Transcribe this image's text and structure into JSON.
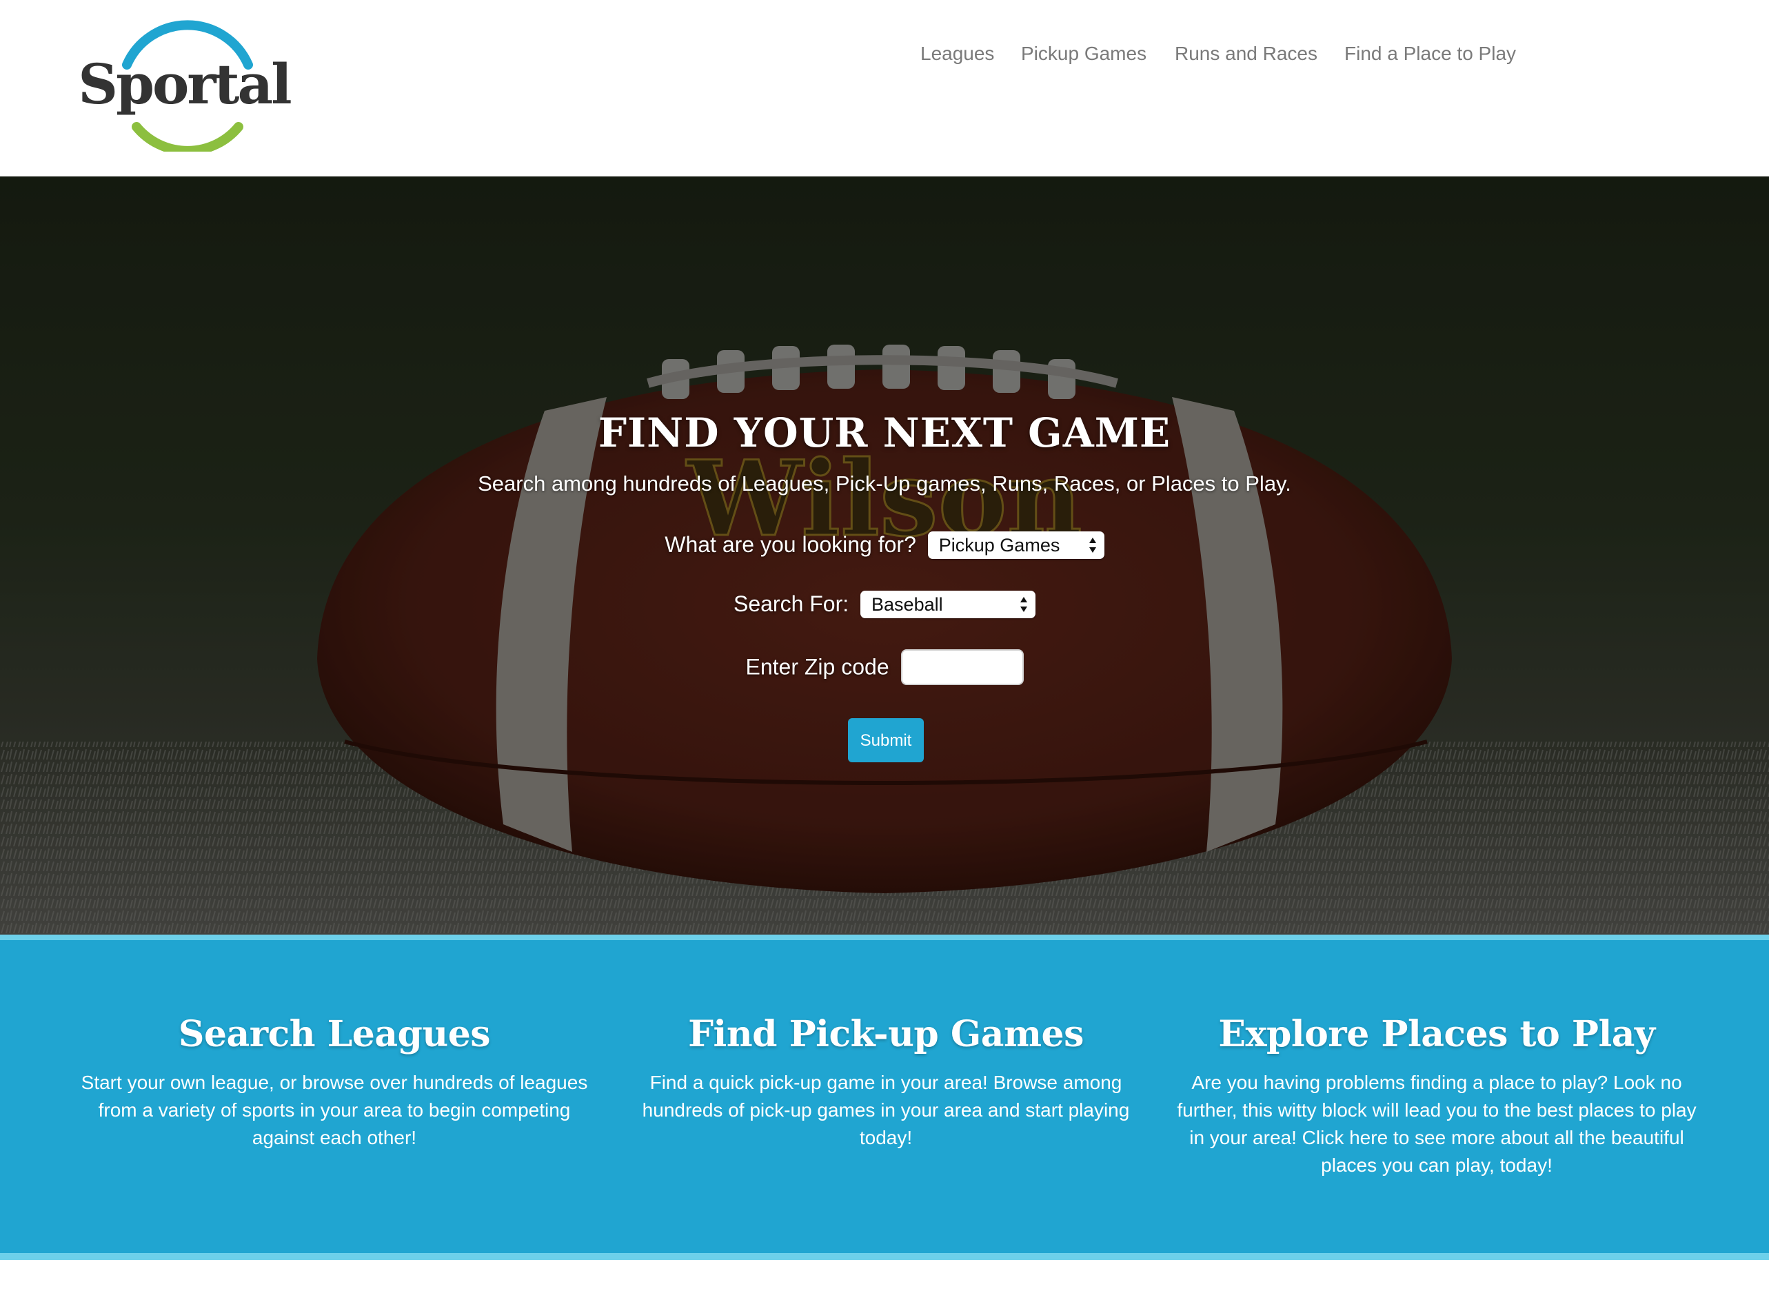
{
  "brand": {
    "logo_text": "Sportal",
    "ring_top_color": "#20a5d1",
    "ring_bottom_color": "#8cbf3f"
  },
  "nav": {
    "items": [
      {
        "label": "Leagues"
      },
      {
        "label": "Pickup Games"
      },
      {
        "label": "Runs and Races"
      },
      {
        "label": "Find a Place to Play"
      }
    ]
  },
  "hero": {
    "title": "FIND YOUR NEXT GAME",
    "subtitle": "Search among hundreds of Leagues, Pick-Up games, Runs, Races, or Places to Play.",
    "looking_for_label": "What are you looking for?",
    "looking_for_value": "Pickup Games",
    "search_for_label": "Search For:",
    "search_for_value": "Baseball",
    "zip_label": "Enter Zip code",
    "zip_value": "",
    "submit_label": "Submit",
    "ball_brand_text": "Wilson"
  },
  "features": [
    {
      "title": "Search Leagues",
      "text": "Start your own league, or browse over hundreds of leagues from a variety of sports in your area to begin competing against each other!"
    },
    {
      "title": "Find Pick-up Games",
      "text": "Find a quick pick-up game in your area! Browse among hundreds of pick-up games in your area and start playing today!"
    },
    {
      "title": "Explore Places to Play",
      "text": "Are you having problems finding a place to play? Look no further, this witty block will lead you to the best places to play in your area! Click here to see more about all the beautiful places you can play, today!"
    }
  ],
  "colors": {
    "accent": "#20a5d1",
    "accent_light": "#6dd0ea",
    "nav_text": "#7a7a7a"
  }
}
